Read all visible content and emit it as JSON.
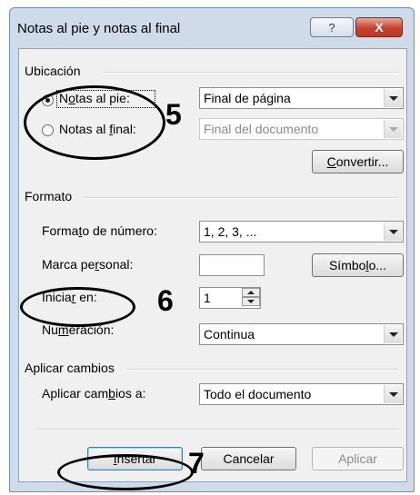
{
  "window": {
    "title": "Notas al pie y notas al final",
    "help_icon": "?",
    "close_icon": "X"
  },
  "ubicacion": {
    "group_label": "Ubicación",
    "notas_pie": {
      "pre": "N",
      "u": "o",
      "post": "tas al pie:",
      "selected": true
    },
    "notas_final": {
      "pre": "Notas al ",
      "u": "f",
      "post": "inal:",
      "selected": false
    },
    "pie_value": "Final de página",
    "final_value": "Final del documento",
    "convertir": {
      "u": "C",
      "post": "onvertir..."
    }
  },
  "formato": {
    "group_label": "Formato",
    "formato_numero": {
      "pre": "Forma",
      "u": "t",
      "post": "o de número:"
    },
    "formato_value": "1, 2, 3, ...",
    "marca_personal": {
      "pre": "Marca pe",
      "u": "r",
      "post": "sonal:"
    },
    "marca_value": "",
    "simbolo": {
      "pre": "Símbo",
      "u": "l",
      "post": "o..."
    },
    "iniciar_en": {
      "pre": "Inicia",
      "u": "r",
      "post": " en:"
    },
    "iniciar_value": "1",
    "numeracion": {
      "pre": "Nu",
      "u": "m",
      "post": "eración:"
    },
    "numeracion_value": "Continua"
  },
  "aplicar_cambios": {
    "group_label": "Aplicar cambios",
    "aplicar_a": {
      "pre": "Aplicar cam",
      "u": "b",
      "post": "ios a:"
    },
    "aplicar_value": "Todo el documento"
  },
  "buttons": {
    "insertar": {
      "u": "I",
      "post": "nsertar"
    },
    "cancelar": "Cancelar",
    "aplicar": "Aplicar"
  },
  "annotations": {
    "a5": "5",
    "a6": "6",
    "a7": "7"
  }
}
